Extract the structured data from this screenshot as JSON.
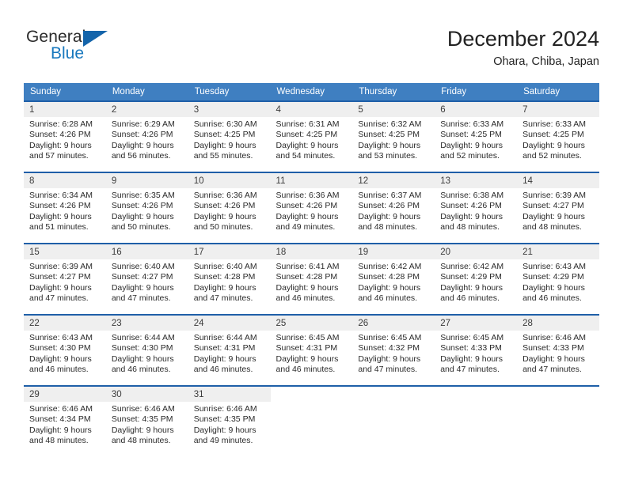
{
  "brand": {
    "name_part1": "General",
    "name_part2": "Blue",
    "logo_icon": "triangle-flag-icon",
    "accent_color": "#1878be",
    "triangle_color": "#1464aa"
  },
  "header": {
    "title": "December 2024",
    "location": "Ohara, Chiba, Japan"
  },
  "theme": {
    "header_row_bg": "#3f7fc1",
    "week_divider": "#1f5fa8",
    "daynum_band_bg": "#efefef",
    "text_color": "#2a2a2a"
  },
  "weekday_headers": [
    "Sunday",
    "Monday",
    "Tuesday",
    "Wednesday",
    "Thursday",
    "Friday",
    "Saturday"
  ],
  "weeks": [
    [
      {
        "day": "1",
        "sunrise": "Sunrise: 6:28 AM",
        "sunset": "Sunset: 4:26 PM",
        "daylight_line1": "Daylight: 9 hours",
        "daylight_line2": "and 57 minutes."
      },
      {
        "day": "2",
        "sunrise": "Sunrise: 6:29 AM",
        "sunset": "Sunset: 4:26 PM",
        "daylight_line1": "Daylight: 9 hours",
        "daylight_line2": "and 56 minutes."
      },
      {
        "day": "3",
        "sunrise": "Sunrise: 6:30 AM",
        "sunset": "Sunset: 4:25 PM",
        "daylight_line1": "Daylight: 9 hours",
        "daylight_line2": "and 55 minutes."
      },
      {
        "day": "4",
        "sunrise": "Sunrise: 6:31 AM",
        "sunset": "Sunset: 4:25 PM",
        "daylight_line1": "Daylight: 9 hours",
        "daylight_line2": "and 54 minutes."
      },
      {
        "day": "5",
        "sunrise": "Sunrise: 6:32 AM",
        "sunset": "Sunset: 4:25 PM",
        "daylight_line1": "Daylight: 9 hours",
        "daylight_line2": "and 53 minutes."
      },
      {
        "day": "6",
        "sunrise": "Sunrise: 6:33 AM",
        "sunset": "Sunset: 4:25 PM",
        "daylight_line1": "Daylight: 9 hours",
        "daylight_line2": "and 52 minutes."
      },
      {
        "day": "7",
        "sunrise": "Sunrise: 6:33 AM",
        "sunset": "Sunset: 4:25 PM",
        "daylight_line1": "Daylight: 9 hours",
        "daylight_line2": "and 52 minutes."
      }
    ],
    [
      {
        "day": "8",
        "sunrise": "Sunrise: 6:34 AM",
        "sunset": "Sunset: 4:26 PM",
        "daylight_line1": "Daylight: 9 hours",
        "daylight_line2": "and 51 minutes."
      },
      {
        "day": "9",
        "sunrise": "Sunrise: 6:35 AM",
        "sunset": "Sunset: 4:26 PM",
        "daylight_line1": "Daylight: 9 hours",
        "daylight_line2": "and 50 minutes."
      },
      {
        "day": "10",
        "sunrise": "Sunrise: 6:36 AM",
        "sunset": "Sunset: 4:26 PM",
        "daylight_line1": "Daylight: 9 hours",
        "daylight_line2": "and 50 minutes."
      },
      {
        "day": "11",
        "sunrise": "Sunrise: 6:36 AM",
        "sunset": "Sunset: 4:26 PM",
        "daylight_line1": "Daylight: 9 hours",
        "daylight_line2": "and 49 minutes."
      },
      {
        "day": "12",
        "sunrise": "Sunrise: 6:37 AM",
        "sunset": "Sunset: 4:26 PM",
        "daylight_line1": "Daylight: 9 hours",
        "daylight_line2": "and 48 minutes."
      },
      {
        "day": "13",
        "sunrise": "Sunrise: 6:38 AM",
        "sunset": "Sunset: 4:26 PM",
        "daylight_line1": "Daylight: 9 hours",
        "daylight_line2": "and 48 minutes."
      },
      {
        "day": "14",
        "sunrise": "Sunrise: 6:39 AM",
        "sunset": "Sunset: 4:27 PM",
        "daylight_line1": "Daylight: 9 hours",
        "daylight_line2": "and 48 minutes."
      }
    ],
    [
      {
        "day": "15",
        "sunrise": "Sunrise: 6:39 AM",
        "sunset": "Sunset: 4:27 PM",
        "daylight_line1": "Daylight: 9 hours",
        "daylight_line2": "and 47 minutes."
      },
      {
        "day": "16",
        "sunrise": "Sunrise: 6:40 AM",
        "sunset": "Sunset: 4:27 PM",
        "daylight_line1": "Daylight: 9 hours",
        "daylight_line2": "and 47 minutes."
      },
      {
        "day": "17",
        "sunrise": "Sunrise: 6:40 AM",
        "sunset": "Sunset: 4:28 PM",
        "daylight_line1": "Daylight: 9 hours",
        "daylight_line2": "and 47 minutes."
      },
      {
        "day": "18",
        "sunrise": "Sunrise: 6:41 AM",
        "sunset": "Sunset: 4:28 PM",
        "daylight_line1": "Daylight: 9 hours",
        "daylight_line2": "and 46 minutes."
      },
      {
        "day": "19",
        "sunrise": "Sunrise: 6:42 AM",
        "sunset": "Sunset: 4:28 PM",
        "daylight_line1": "Daylight: 9 hours",
        "daylight_line2": "and 46 minutes."
      },
      {
        "day": "20",
        "sunrise": "Sunrise: 6:42 AM",
        "sunset": "Sunset: 4:29 PM",
        "daylight_line1": "Daylight: 9 hours",
        "daylight_line2": "and 46 minutes."
      },
      {
        "day": "21",
        "sunrise": "Sunrise: 6:43 AM",
        "sunset": "Sunset: 4:29 PM",
        "daylight_line1": "Daylight: 9 hours",
        "daylight_line2": "and 46 minutes."
      }
    ],
    [
      {
        "day": "22",
        "sunrise": "Sunrise: 6:43 AM",
        "sunset": "Sunset: 4:30 PM",
        "daylight_line1": "Daylight: 9 hours",
        "daylight_line2": "and 46 minutes."
      },
      {
        "day": "23",
        "sunrise": "Sunrise: 6:44 AM",
        "sunset": "Sunset: 4:30 PM",
        "daylight_line1": "Daylight: 9 hours",
        "daylight_line2": "and 46 minutes."
      },
      {
        "day": "24",
        "sunrise": "Sunrise: 6:44 AM",
        "sunset": "Sunset: 4:31 PM",
        "daylight_line1": "Daylight: 9 hours",
        "daylight_line2": "and 46 minutes."
      },
      {
        "day": "25",
        "sunrise": "Sunrise: 6:45 AM",
        "sunset": "Sunset: 4:31 PM",
        "daylight_line1": "Daylight: 9 hours",
        "daylight_line2": "and 46 minutes."
      },
      {
        "day": "26",
        "sunrise": "Sunrise: 6:45 AM",
        "sunset": "Sunset: 4:32 PM",
        "daylight_line1": "Daylight: 9 hours",
        "daylight_line2": "and 47 minutes."
      },
      {
        "day": "27",
        "sunrise": "Sunrise: 6:45 AM",
        "sunset": "Sunset: 4:33 PM",
        "daylight_line1": "Daylight: 9 hours",
        "daylight_line2": "and 47 minutes."
      },
      {
        "day": "28",
        "sunrise": "Sunrise: 6:46 AM",
        "sunset": "Sunset: 4:33 PM",
        "daylight_line1": "Daylight: 9 hours",
        "daylight_line2": "and 47 minutes."
      }
    ],
    [
      {
        "day": "29",
        "sunrise": "Sunrise: 6:46 AM",
        "sunset": "Sunset: 4:34 PM",
        "daylight_line1": "Daylight: 9 hours",
        "daylight_line2": "and 48 minutes."
      },
      {
        "day": "30",
        "sunrise": "Sunrise: 6:46 AM",
        "sunset": "Sunset: 4:35 PM",
        "daylight_line1": "Daylight: 9 hours",
        "daylight_line2": "and 48 minutes."
      },
      {
        "day": "31",
        "sunrise": "Sunrise: 6:46 AM",
        "sunset": "Sunset: 4:35 PM",
        "daylight_line1": "Daylight: 9 hours",
        "daylight_line2": "and 49 minutes."
      },
      {
        "day": "",
        "sunrise": "",
        "sunset": "",
        "daylight_line1": "",
        "daylight_line2": ""
      },
      {
        "day": "",
        "sunrise": "",
        "sunset": "",
        "daylight_line1": "",
        "daylight_line2": ""
      },
      {
        "day": "",
        "sunrise": "",
        "sunset": "",
        "daylight_line1": "",
        "daylight_line2": ""
      },
      {
        "day": "",
        "sunrise": "",
        "sunset": "",
        "daylight_line1": "",
        "daylight_line2": ""
      }
    ]
  ]
}
